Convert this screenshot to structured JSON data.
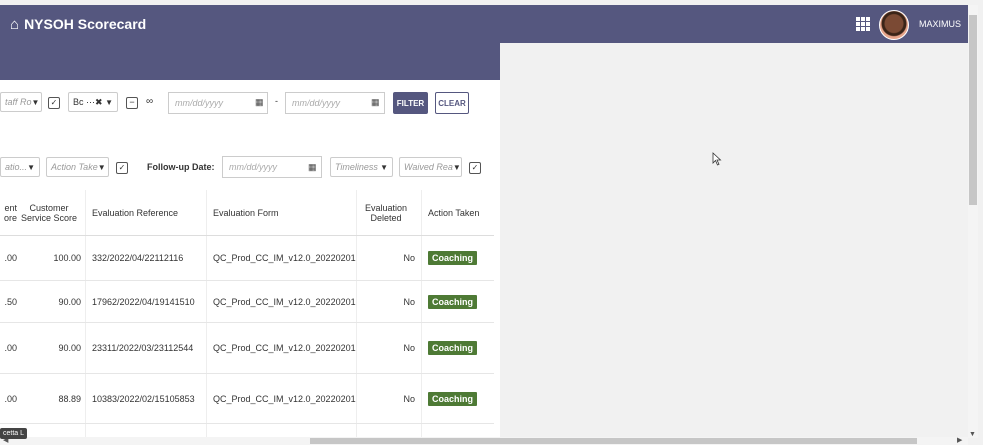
{
  "app": {
    "title": "NYSOH Scorecard",
    "user": "MAXIMUS"
  },
  "filters1": {
    "staff_role": "taff Ro",
    "bc": "Bc",
    "date_from_placeholder": "mm/dd/yyyy",
    "date_sep": "-",
    "date_to_placeholder": "mm/dd/yyyy",
    "filter_label": "FILTER",
    "clear_label": "CLEAR"
  },
  "filters2": {
    "evaluation": "atio...",
    "action_taken": "Action Take",
    "followup_label": "Follow-up Date:",
    "followup_placeholder": "mm/dd/yyyy",
    "timeliness": "Timeliness",
    "waived_reason": "Waived Rea"
  },
  "table": {
    "headers": {
      "partial": "ent\nore",
      "customer_service": "Customer Service Score",
      "reference": "Evaluation Reference",
      "form": "Evaluation Form",
      "deleted": "Evaluation Deleted",
      "action": "Action Taken"
    },
    "rows": [
      {
        "partial": ".00",
        "score": "100.00",
        "reference": "332/2022/04/22112116",
        "form": "QC_Prod_CC_IM_v12.0_20220201",
        "deleted": "No",
        "action": "Coaching"
      },
      {
        "partial": ".50",
        "score": "90.00",
        "reference": "17962/2022/04/19141510",
        "form": "QC_Prod_CC_IM_v12.0_20220201",
        "deleted": "No",
        "action": "Coaching"
      },
      {
        "partial": ".00",
        "score": "90.00",
        "reference": "23311/2022/03/23112544",
        "form": "QC_Prod_CC_IM_v12.0_20220201",
        "deleted": "No",
        "action": "Coaching"
      },
      {
        "partial": ".00",
        "score": "88.89",
        "reference": "10383/2022/02/15105853",
        "form": "QC_Prod_CC_IM_v12.0_20220201",
        "deleted": "No",
        "action": "Coaching"
      }
    ]
  },
  "tooltip": "cetta L"
}
